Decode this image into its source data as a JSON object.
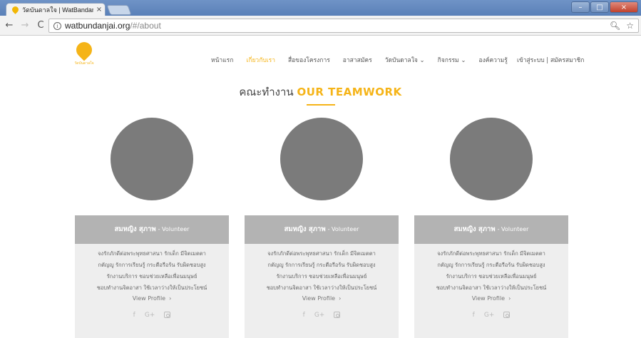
{
  "browser": {
    "tab_title": "วัดบันดาลใจ | WatBandanj",
    "tab_close": "×",
    "url_host": "watbundanjai.org",
    "url_path": "/#/about",
    "window_buttons": [
      "–",
      "□",
      "×"
    ]
  },
  "site": {
    "logo_text": "วัดบันดาลใจ",
    "nav": [
      {
        "label": "หน้าแรก",
        "active": false
      },
      {
        "label": "เกี่ยวกับเรา",
        "active": true
      },
      {
        "label": "สื่อของโครงการ",
        "active": false
      },
      {
        "label": "อาสาสมัคร",
        "active": false
      },
      {
        "label": "วัดบันดาลใจ ⌄",
        "active": false
      },
      {
        "label": "กิจกรรม ⌄",
        "active": false
      },
      {
        "label": "องค์ความรู้",
        "active": false
      }
    ],
    "auth": "เข้าสู่ระบบ | สมัครสมาชิก"
  },
  "section": {
    "title_th": "คณะทำงาน",
    "title_en": "OUR TEAMWORK"
  },
  "team": [
    {
      "name": "สมหญิง สุภาพ",
      "role": "- Volunteer",
      "bio": [
        "จงรักภักดีต่อพระพุทธศาสนา รักเด็ก มีจิตเมตตา",
        "กตัญญู รักการเรียนรู้ กระตือรือร้น รับผิดชอบสูง",
        "รักงานบริการ ชอบช่วยเหลือเพื่อนมนุษย์",
        "ชอบทำงานจิตอาสา ใช้เวลาว่างให้เป็นประโยชน์"
      ],
      "view_profile": "View Profile",
      "socials": [
        "f",
        "G+"
      ]
    },
    {
      "name": "สมหญิง สุภาพ",
      "role": "- Volunteer",
      "bio": [
        "จงรักภักดีต่อพระพุทธศาสนา รักเด็ก มีจิตเมตตา",
        "กตัญญู รักการเรียนรู้ กระตือรือร้น รับผิดชอบสูง",
        "รักงานบริการ ชอบช่วยเหลือเพื่อนมนุษย์",
        "ชอบทำงานจิตอาสา ใช้เวลาว่างให้เป็นประโยชน์"
      ],
      "view_profile": "View Profile",
      "socials": [
        "f",
        "G+"
      ]
    },
    {
      "name": "สมหญิง สุภาพ",
      "role": "- Volunteer",
      "bio": [
        "จงรักภักดีต่อพระพุทธศาสนา รักเด็ก มีจิตเมตตา",
        "กตัญญู รักการเรียนรู้ กระตือรือร้น รับผิดชอบสูง",
        "รักงานบริการ ชอบช่วยเหลือเพื่อนมนุษย์",
        "ชอบทำงานจิตอาสา ใช้เวลาว่างให้เป็นประโยชน์"
      ],
      "view_profile": "View Profile",
      "socials": [
        "f",
        "G+"
      ]
    }
  ],
  "colors": {
    "accent": "#f5b418",
    "card_header": "#b3b3b3",
    "card_body": "#eeeeee",
    "avatar": "#7b7b7b"
  }
}
